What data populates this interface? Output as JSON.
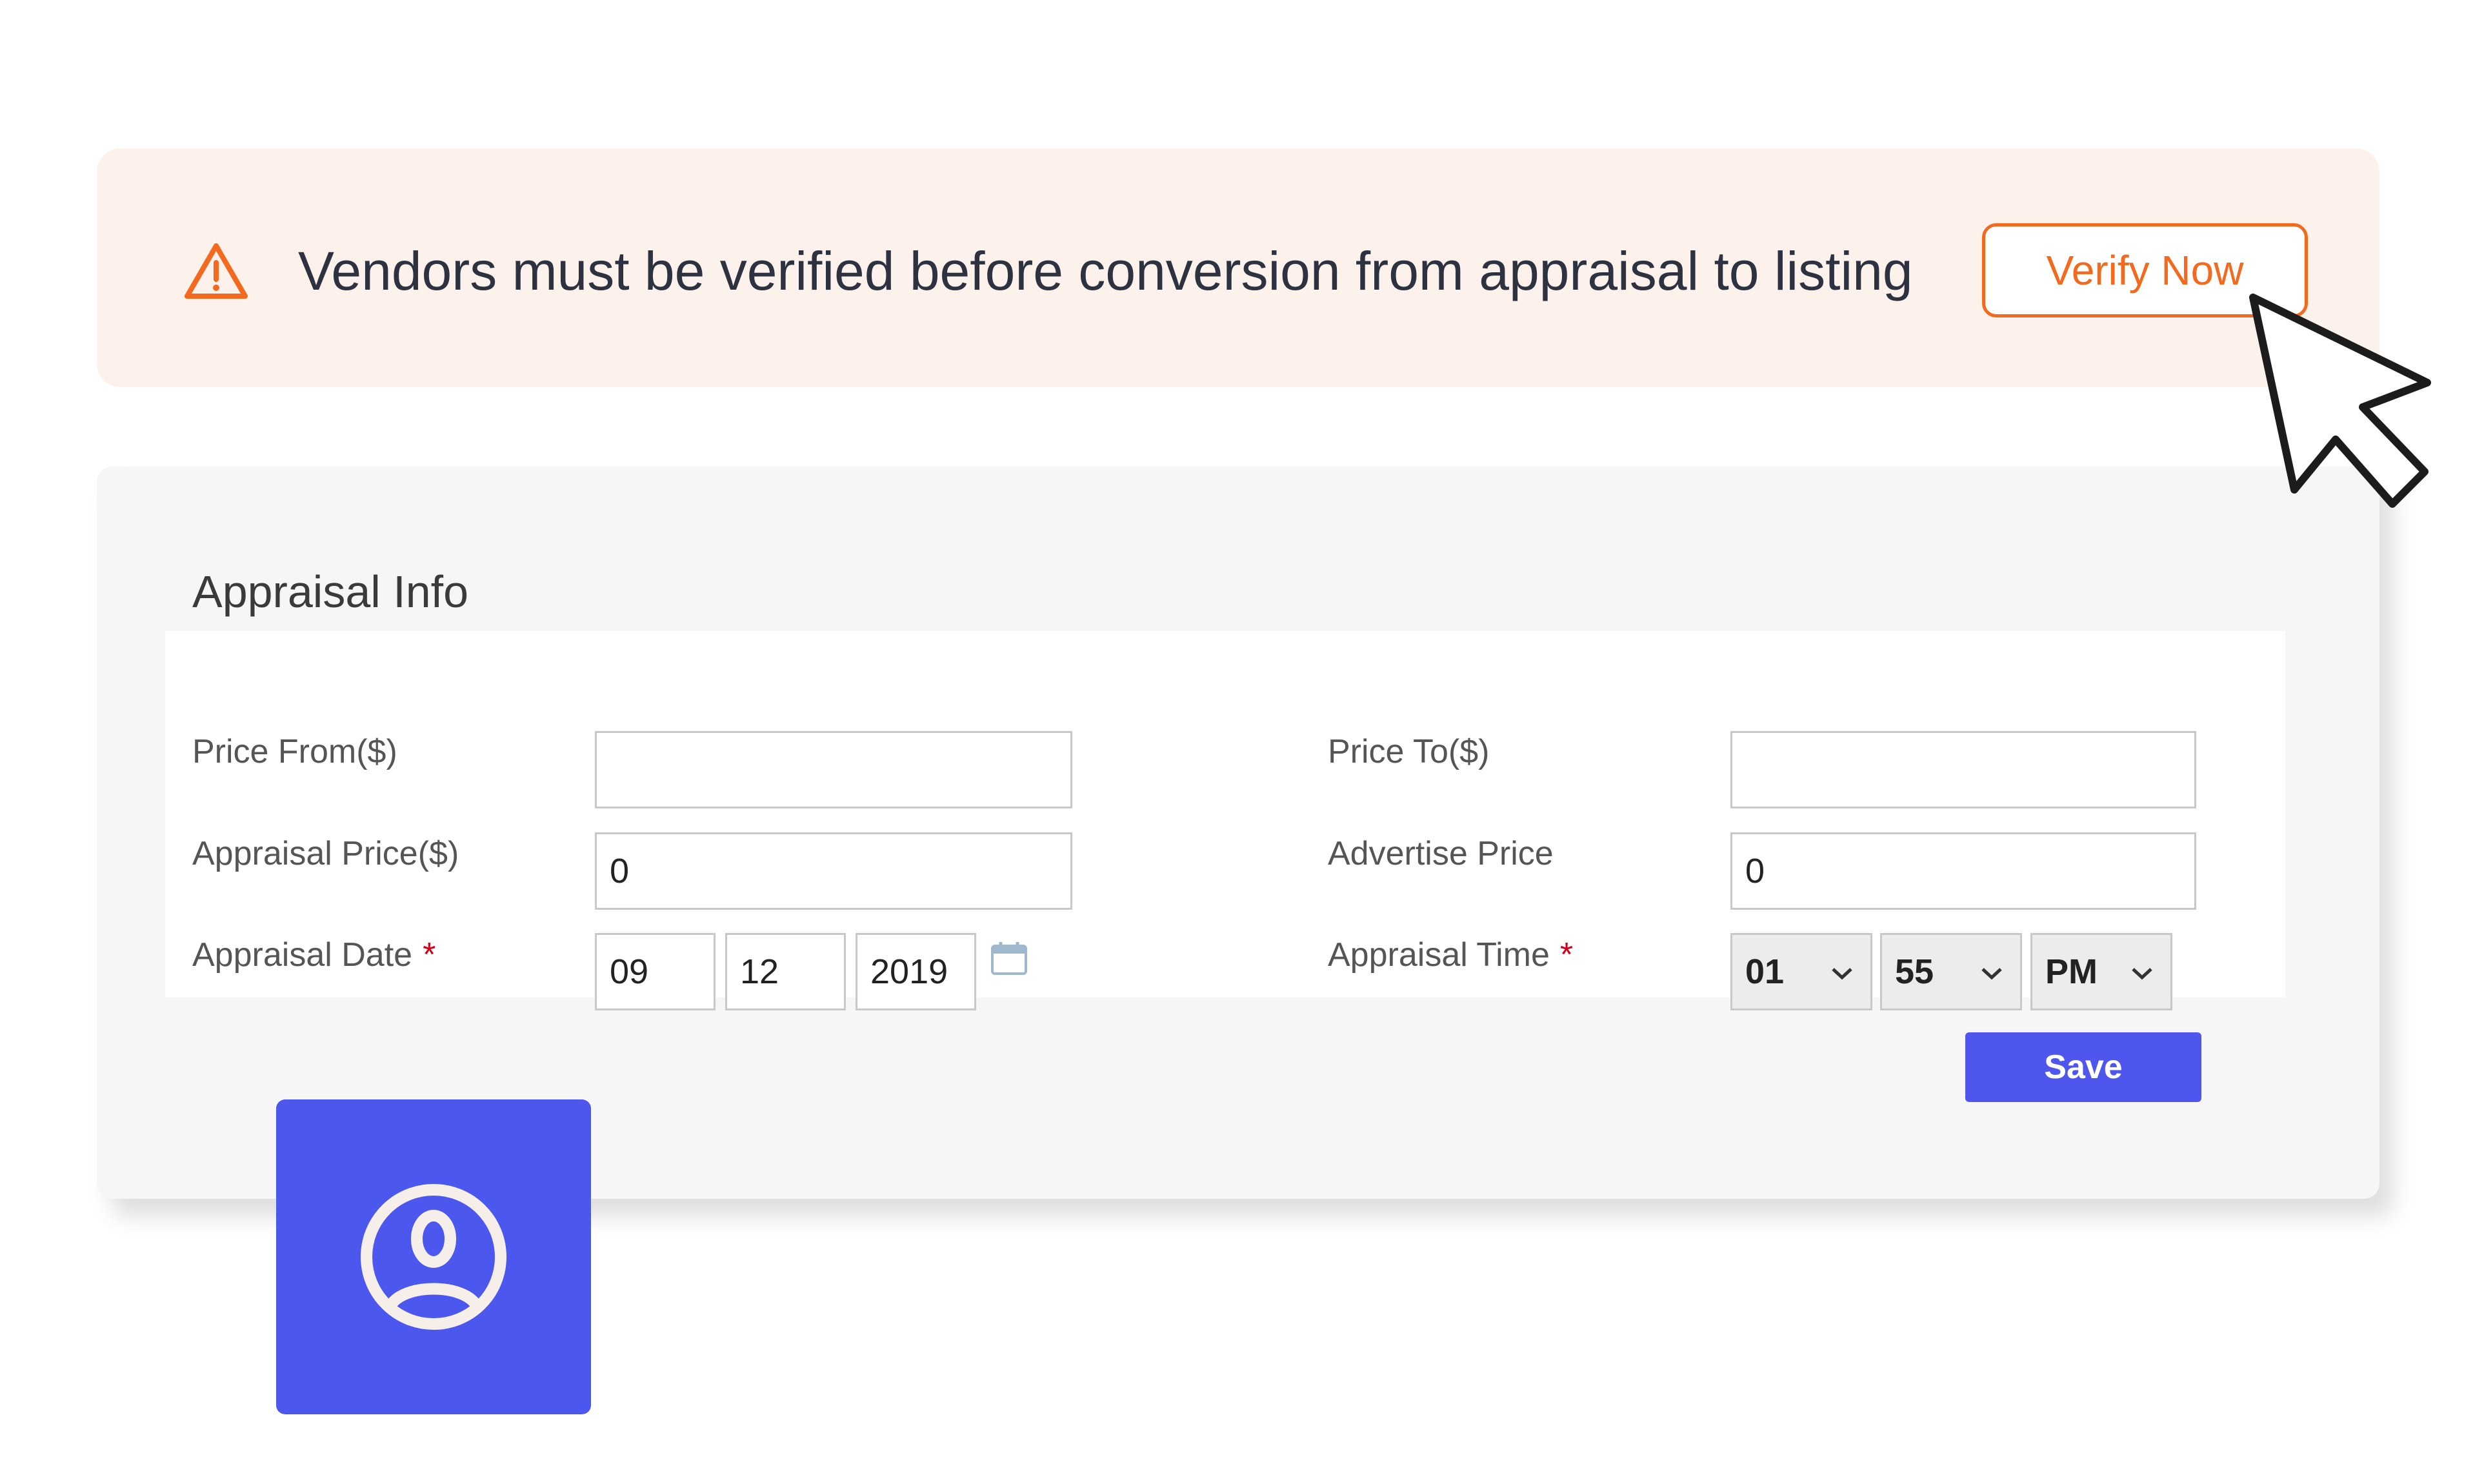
{
  "banner": {
    "message": "Vendors must be verified before conversion from appraisal to listing",
    "button_label": "Verify Now",
    "icon": "warning-triangle-icon",
    "accent_color": "#f36a1f",
    "background_color": "#fdf1ec"
  },
  "appraisal": {
    "title": "Appraisal Info",
    "fields": {
      "price_from": {
        "label": "Price From($)",
        "value": ""
      },
      "price_to": {
        "label": "Price To($)",
        "value": ""
      },
      "appraisal_price": {
        "label": "Appraisal Price($)",
        "value": "0"
      },
      "advertise_price": {
        "label": "Advertise Price",
        "value": "0"
      },
      "appraisal_date": {
        "label": "Appraisal Date",
        "required_mark": "*",
        "month": "09",
        "day": "12",
        "year": "2019"
      },
      "appraisal_time": {
        "label": "Appraisal Time",
        "required_mark": "*",
        "hour": "01",
        "minute": "55",
        "period": "PM"
      }
    },
    "save_label": "Save",
    "save_color": "#4e56ee"
  },
  "decor": {
    "avatar_icon": "user-circle-icon",
    "cursor_icon": "mouse-pointer-icon",
    "tile_color": "#4c57ee"
  }
}
